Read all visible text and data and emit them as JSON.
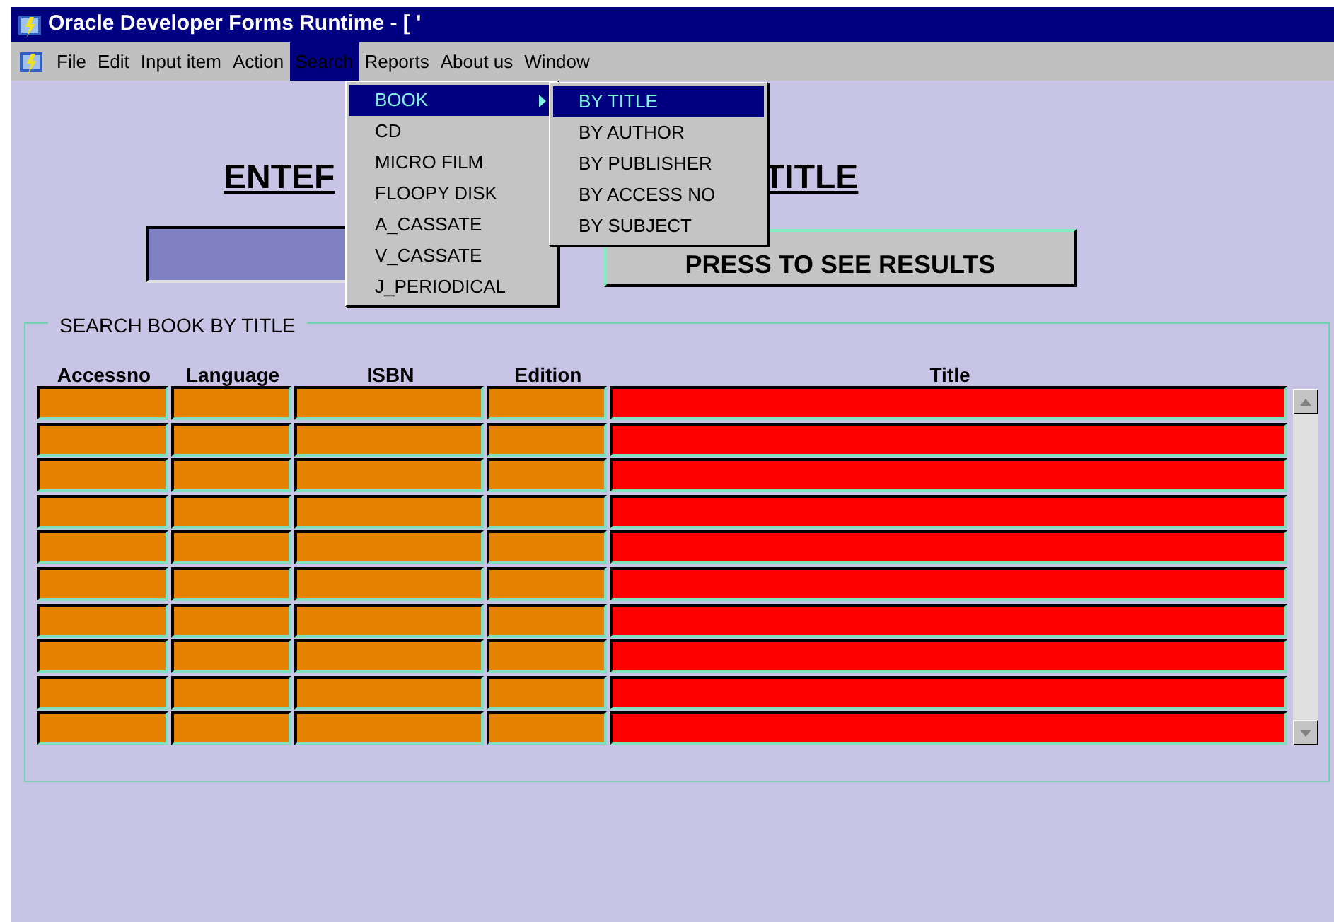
{
  "window": {
    "title": "Oracle Developer Forms Runtime - [ '"
  },
  "menu_bar": [
    {
      "label": "File",
      "selected": false
    },
    {
      "label": "Edit",
      "selected": false
    },
    {
      "label": "Input item",
      "selected": false
    },
    {
      "label": "Action",
      "selected": false
    },
    {
      "label": "Search",
      "selected": true
    },
    {
      "label": "Reports",
      "selected": false
    },
    {
      "label": "About us",
      "selected": false
    },
    {
      "label": "Window",
      "selected": false
    }
  ],
  "search_menu": [
    {
      "label": "BOOK",
      "selected": true,
      "submenu": true
    },
    {
      "label": "CD",
      "selected": false,
      "submenu": false
    },
    {
      "label": "MICRO FILM",
      "selected": false,
      "submenu": false
    },
    {
      "label": "FLOOPY DISK",
      "selected": false,
      "submenu": false
    },
    {
      "label": "A_CASSATE",
      "selected": false,
      "submenu": false
    },
    {
      "label": "V_CASSATE",
      "selected": false,
      "submenu": false
    },
    {
      "label": "J_PERIODICAL",
      "selected": false,
      "submenu": false
    }
  ],
  "book_submenu": [
    {
      "label": "BY TITLE",
      "selected": true
    },
    {
      "label": "BY AUTHOR",
      "selected": false
    },
    {
      "label": "BY PUBLISHER",
      "selected": false
    },
    {
      "label": "BY ACCESS NO",
      "selected": false
    },
    {
      "label": "BY SUBJECT",
      "selected": false
    }
  ],
  "heading": {
    "left": "ENTEF",
    "right": "TITLE"
  },
  "results_button": "PRESS TO SEE RESULTS",
  "group": {
    "legend": "SEARCH BOOK BY TITLE"
  },
  "table": {
    "columns": [
      {
        "label": "Accessno",
        "color": "#e68200"
      },
      {
        "label": "Language",
        "color": "#e68200"
      },
      {
        "label": "ISBN",
        "color": "#e68200"
      },
      {
        "label": "Edition",
        "color": "#e68200"
      },
      {
        "label": "Title",
        "color": "#ff0000"
      }
    ]
  }
}
